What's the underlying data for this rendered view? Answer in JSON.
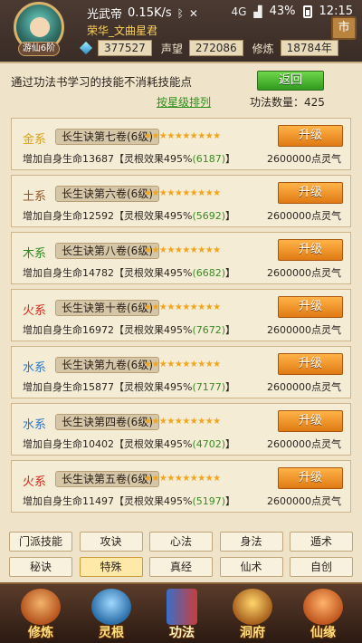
{
  "status_bar": {
    "app": "光武帝",
    "speed": "0.15K/s",
    "network": "4G",
    "battery": "43%",
    "time": "12:15"
  },
  "player": {
    "level_badge": "游仙6阶",
    "name": "荣华_文曲星君",
    "currency_value": "377527",
    "prestige_label": "声望",
    "prestige_value": "272086",
    "cultivation_label": "修炼",
    "cultivation_value": "18784年",
    "shop_label": "市"
  },
  "header": {
    "intro": "通过功法书学习的技能不消耗技能点",
    "back_button": "返回",
    "sort_link": "按星级排列",
    "count_text": "功法数量：425"
  },
  "skills": [
    {
      "element": "金系",
      "element_class": "el-gold",
      "name": "长生诀第七卷(6级)",
      "stars": "★★★★★★★★★★",
      "upgrade": "升级",
      "effect_prefix": "增加自身生命13687【灵根效果495%",
      "effect_green": "(6187)",
      "effect_suffix": "】",
      "cost": "2600000点灵气"
    },
    {
      "element": "土系",
      "element_class": "el-earth",
      "name": "长生诀第六卷(6级)",
      "stars": "★★★★★★★★★★",
      "upgrade": "升级",
      "effect_prefix": "增加自身生命12592【灵根效果495%",
      "effect_green": "(5692)",
      "effect_suffix": "】",
      "cost": "2600000点灵气"
    },
    {
      "element": "木系",
      "element_class": "el-wood",
      "name": "长生诀第八卷(6级)",
      "stars": "★★★★★★★★★★",
      "upgrade": "升级",
      "effect_prefix": "增加自身生命14782【灵根效果495%",
      "effect_green": "(6682)",
      "effect_suffix": "】",
      "cost": "2600000点灵气"
    },
    {
      "element": "火系",
      "element_class": "el-fire",
      "name": "长生诀第十卷(6级)",
      "stars": "★★★★★★★★★★",
      "upgrade": "升级",
      "effect_prefix": "增加自身生命16972【灵根效果495%",
      "effect_green": "(7672)",
      "effect_suffix": "】",
      "cost": "2600000点灵气"
    },
    {
      "element": "水系",
      "element_class": "el-water",
      "name": "长生诀第九卷(6级)",
      "stars": "★★★★★★★★★★",
      "upgrade": "升级",
      "effect_prefix": "增加自身生命15877【灵根效果495%",
      "effect_green": "(7177)",
      "effect_suffix": "】",
      "cost": "2600000点灵气"
    },
    {
      "element": "水系",
      "element_class": "el-water",
      "name": "长生诀第四卷(6级)",
      "stars": "★★★★★★★★★★",
      "upgrade": "升级",
      "effect_prefix": "增加自身生命10402【灵根效果495%",
      "effect_green": "(4702)",
      "effect_suffix": "】",
      "cost": "2600000点灵气"
    },
    {
      "element": "火系",
      "element_class": "el-fire",
      "name": "长生诀第五卷(6级)",
      "stars": "★★★★★★★★★★",
      "upgrade": "升级",
      "effect_prefix": "增加自身生命11497【灵根效果495%",
      "effect_green": "(5197)",
      "effect_suffix": "】",
      "cost": "2600000点灵气"
    }
  ],
  "tabs_row1": [
    "门派技能",
    "攻诀",
    "心法",
    "身法",
    "遁术"
  ],
  "tabs_row2": [
    "秘诀",
    "特殊",
    "真经",
    "仙术",
    "自创"
  ],
  "active_tab": "特殊",
  "bottom_nav": [
    {
      "label": "修炼",
      "icon": "cultivation-icon",
      "color": "#c9662a"
    },
    {
      "label": "灵根",
      "icon": "spirit-root-icon",
      "color": "#3d8ec9"
    },
    {
      "label": "功法",
      "icon": "skill-book-icon",
      "color": "#c93d3d"
    },
    {
      "label": "洞府",
      "icon": "cave-icon",
      "color": "#d99a2a"
    },
    {
      "label": "仙缘",
      "icon": "gourd-icon",
      "color": "#d6752a"
    }
  ],
  "active_nav": "功法"
}
